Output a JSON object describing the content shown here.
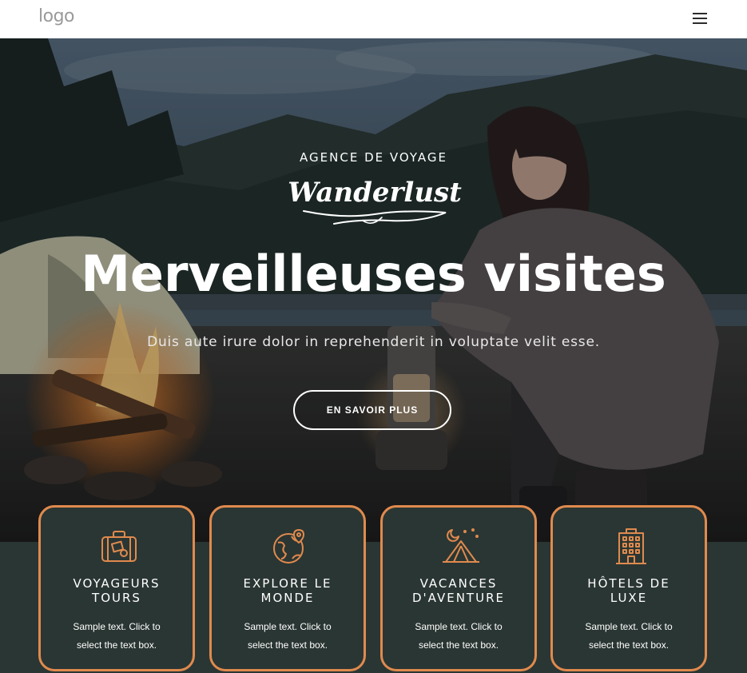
{
  "header": {
    "logo_text": "logo",
    "menu_icon": "hamburger-menu-icon"
  },
  "hero": {
    "eyebrow": "AGENCE DE VOYAGE",
    "brand_script": "Wanderlust",
    "headline": "Merveilleuses visites",
    "subtitle": "Duis aute irure dolor in reprehenderit in voluptate velit esse.",
    "cta_label": "EN SAVOIR PLUS"
  },
  "colors": {
    "accent": "#e08a4e",
    "dark_band": "#2a3633",
    "header_bg": "#ffffff"
  },
  "cards": [
    {
      "icon": "suitcase-icon",
      "title_line1": "VOYAGEURS",
      "title_line2": "TOURS",
      "desc_line1": "Sample text. Click to",
      "desc_line2": "select the text box."
    },
    {
      "icon": "globe-pin-icon",
      "title_line1": "EXPLORE LE",
      "title_line2": "MONDE",
      "desc_line1": "Sample text. Click to",
      "desc_line2": "select the text box."
    },
    {
      "icon": "tent-moon-icon",
      "title_line1": "VACANCES",
      "title_line2": "D'AVENTURE",
      "desc_line1": "Sample text. Click to",
      "desc_line2": "select the text box."
    },
    {
      "icon": "hotel-building-icon",
      "title_line1": "HÔTELS DE",
      "title_line2": "LUXE",
      "desc_line1": "Sample text. Click to",
      "desc_line2": "select the text box."
    }
  ]
}
